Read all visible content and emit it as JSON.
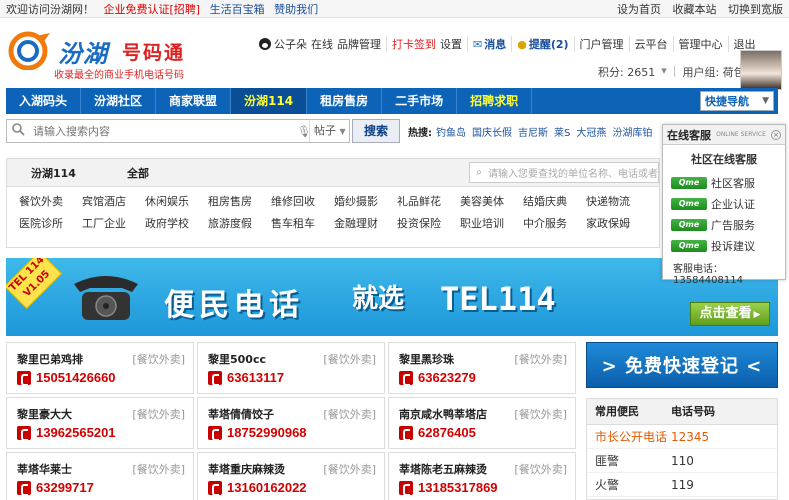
{
  "topbar": {
    "welcome": "欢迎访问汾湖网！",
    "links_left": [
      "企业免费认证[招聘]",
      "生活百宝箱",
      "赞助我们"
    ],
    "links_right": [
      "设为首页",
      "收藏本站",
      "切换到宽版"
    ]
  },
  "header": {
    "brand": "汾湖",
    "brand_sub": "号码通",
    "slogan": "收录最全的商业手机电话号码",
    "user": "公子朵",
    "online_status": "在线",
    "brand_manage": "品牌管理",
    "checkin": "打卡签到",
    "settings": "设置",
    "messages": "消息",
    "reminder": "提醒(2)",
    "portal": "门户管理",
    "cloud": "云平台",
    "admin": "管理中心",
    "logout": "退出",
    "points": "积分: 2651",
    "usergroup": "用户组: 荷包蛋"
  },
  "nav": {
    "items": [
      "入湖码头",
      "汾湖社区",
      "商家联盟",
      "汾湖114",
      "租房售房",
      "二手市场",
      "招聘求职"
    ],
    "quick_nav": "快捷导航"
  },
  "search": {
    "placeholder": "请输入搜索内容",
    "type": "帖子",
    "button": "搜索",
    "hot_label": "热搜:",
    "hot_words": [
      "钓鱼岛",
      "国庆长假",
      "吉尼斯",
      "莱S",
      "大冠燕",
      "汾湖库铂"
    ]
  },
  "catpanel": {
    "tabs": [
      "汾湖114",
      "全部"
    ],
    "search_placeholder": "请输入您要查找的单位名称、电话或者",
    "categories": [
      "餐饮外卖",
      "宾馆酒店",
      "休闲娱乐",
      "租房售房",
      "维修回收",
      "婚纱摄影",
      "礼品鲜花",
      "美容美体",
      "结婚庆典",
      "快递物流",
      "医院诊所",
      "工厂企业",
      "政府学校",
      "旅游度假",
      "售车租车",
      "金融理财",
      "投资保险",
      "职业培训",
      "中介服务",
      "家政保姆"
    ]
  },
  "banner": {
    "tag": "TEL 114 V1.05",
    "main": "便民电话",
    "mid": "就选",
    "tel": "TEL114",
    "button": "点击查看"
  },
  "cards": [
    {
      "name": "黎里巴弟鸡排",
      "cat": "[餐饮外卖]",
      "tel": "15051426660"
    },
    {
      "name": "黎里500cc",
      "cat": "[餐饮外卖]",
      "tel": "63613117"
    },
    {
      "name": "黎里黑珍珠",
      "cat": "[餐饮外卖]",
      "tel": "63623279"
    },
    {
      "name": "黎里豪大大",
      "cat": "[餐饮外卖]",
      "tel": "13962565201"
    },
    {
      "name": "莘塔倩倩饺子",
      "cat": "[餐饮外卖]",
      "tel": "18752990968"
    },
    {
      "name": "南京咸水鸭莘塔店",
      "cat": "[餐饮外卖]",
      "tel": "62876405"
    },
    {
      "name": "莘塔华莱士",
      "cat": "[餐饮外卖]",
      "tel": "63299717"
    },
    {
      "name": "莘塔重庆麻辣烫",
      "cat": "[餐饮外卖]",
      "tel": "13160162022"
    },
    {
      "name": "莘塔陈老五麻辣烫",
      "cat": "[餐饮外卖]",
      "tel": "13185317869"
    }
  ],
  "register": {
    "label": "> 免费快速登记 <"
  },
  "common": {
    "headers": [
      "常用便民",
      "电话号码"
    ],
    "rows": [
      {
        "name": "市长公开电话",
        "tel": "12345"
      },
      {
        "name": "匪警",
        "tel": "110"
      },
      {
        "name": "火警",
        "tel": "119"
      }
    ]
  },
  "online": {
    "header": "在线客服",
    "header_en": "ONLINE SERVICE",
    "title": "社区在线客服",
    "items": [
      "社区客服",
      "企业认证",
      "广告服务",
      "投诉建议"
    ],
    "qme": "Qme",
    "tel": "客服电话：13584408114"
  },
  "colors": {
    "nav": "#0c63b8",
    "accent_red": "#d20000",
    "banner": "#1d97d9"
  }
}
